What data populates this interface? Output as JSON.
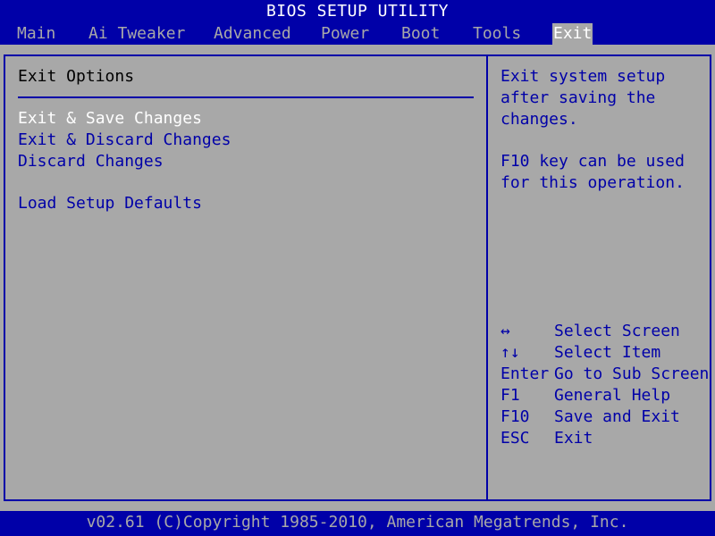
{
  "title": "BIOS SETUP UTILITY",
  "menu": [
    {
      "label": "Main"
    },
    {
      "label": "Ai Tweaker"
    },
    {
      "label": "Advanced"
    },
    {
      "label": "Power"
    },
    {
      "label": "Boot"
    },
    {
      "label": "Tools"
    },
    {
      "label": "Exit",
      "active": true
    }
  ],
  "section": {
    "title": "Exit Options"
  },
  "options": [
    {
      "label": "Exit & Save Changes",
      "selected": true
    },
    {
      "label": "Exit & Discard Changes"
    },
    {
      "label": "Discard Changes"
    },
    {
      "label": "Load Setup Defaults"
    }
  ],
  "help": {
    "lines": [
      "Exit system setup",
      "after saving the",
      "changes.",
      "",
      "F10 key can be used",
      "for this operation."
    ]
  },
  "keys": [
    {
      "key": "↔",
      "desc": "Select Screen"
    },
    {
      "key": "↑↓",
      "desc": "Select Item"
    },
    {
      "key": "Enter",
      "desc": "Go to Sub Screen"
    },
    {
      "key": "F1",
      "desc": "General Help"
    },
    {
      "key": "F10",
      "desc": "Save and Exit"
    },
    {
      "key": "ESC",
      "desc": "Exit"
    }
  ],
  "footer": "v02.61 (C)Copyright 1985-2010, American Megatrends, Inc.",
  "colors": {
    "background": "#a8a8a8",
    "accent": "#0000a8",
    "selected_text": "#ffffff"
  }
}
